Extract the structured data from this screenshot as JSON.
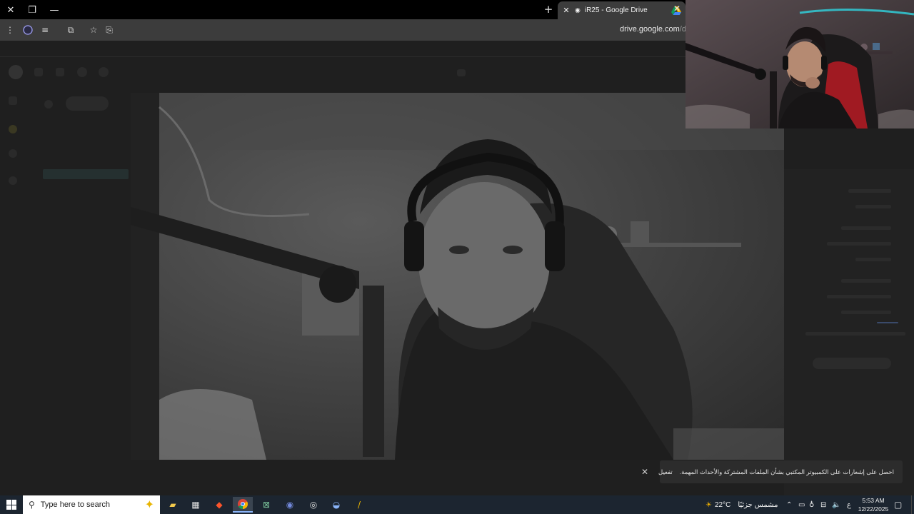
{
  "browser": {
    "tab_title": "iR25 - Google Drive",
    "url_main": "drive.google.com",
    "url_path": "/drive"
  },
  "notification": {
    "text": "احصل على إشعارات على الكمبيوتر المكتبي بشأن الملفات المشتركة والأحداث المهمة.",
    "action": "تفعيل"
  },
  "taskbar": {
    "search_placeholder": "Type here to search",
    "weather_temp": "22°C",
    "weather_desc": "مشمس جزئيًا",
    "lang": "ع",
    "time": "5:53 AM",
    "date": "12/22/2025"
  },
  "icons": [
    "close-icon",
    "restore-icon",
    "minimize-icon",
    "new-tab-icon",
    "drive-icon",
    "menu-icon",
    "profile-icon",
    "media-icon",
    "extensions-icon",
    "star-icon",
    "tab-search-icon",
    "windows-start-icon",
    "search-icon",
    "file-explorer-icon",
    "store-icon",
    "brave-icon",
    "chrome-icon",
    "xbox-icon",
    "discord-icon",
    "obs-icon",
    "steam-icon",
    "app-icon",
    "chevron-up-icon",
    "network-icon",
    "mic-icon",
    "volume-icon",
    "notification-icon"
  ]
}
